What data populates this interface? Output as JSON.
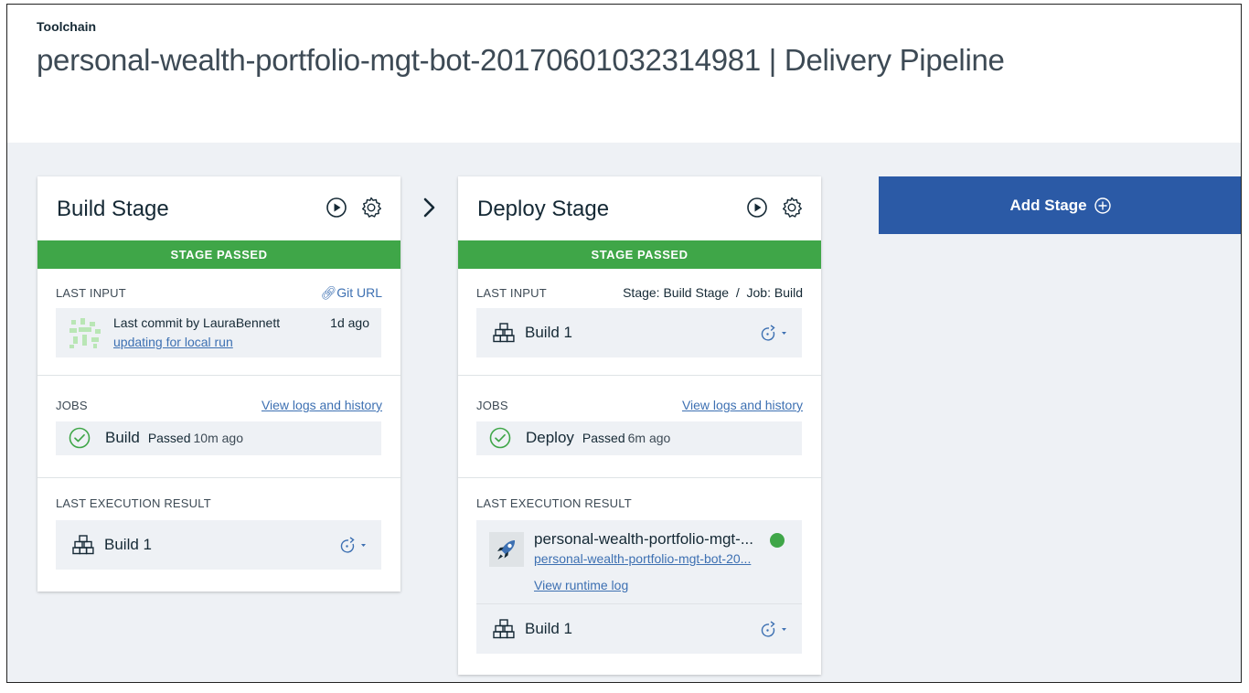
{
  "header": {
    "breadcrumb": "Toolchain",
    "title": "personal-wealth-portfolio-mgt-bot-20170601032314981 | Delivery Pipeline"
  },
  "colors": {
    "passed": "#3fa648",
    "link": "#3d70b2",
    "add_stage_bg": "#2b5aa6",
    "canvas_bg": "#eef1f5"
  },
  "add_stage": {
    "label": "Add Stage",
    "icon": "plus-circle-icon"
  },
  "build_stage": {
    "title": "Build Stage",
    "status": "STAGE PASSED",
    "last_input": {
      "label": "LAST INPUT",
      "link": "Git URL",
      "commit_text": "Last commit by LauraBennett",
      "commit_message": "updating for local run",
      "commit_time": "1d ago"
    },
    "jobs": {
      "label": "JOBS",
      "link": "View logs and history",
      "job_name": "Build",
      "job_status": "Passed",
      "job_time": "10m ago"
    },
    "last_execution": {
      "label": "LAST EXECUTION RESULT",
      "build": "Build 1"
    }
  },
  "deploy_stage": {
    "title": "Deploy Stage",
    "status": "STAGE PASSED",
    "last_input": {
      "label": "LAST INPUT",
      "source": "Stage: Build Stage  /  Job: Build",
      "build": "Build 1"
    },
    "jobs": {
      "label": "JOBS",
      "link": "View logs and history",
      "job_name": "Deploy",
      "job_status": "Passed",
      "job_time": "6m ago"
    },
    "last_execution": {
      "label": "LAST EXECUTION RESULT",
      "app_name": "personal-wealth-portfolio-mgt-...",
      "app_route": "personal-wealth-portfolio-mgt-bot-20...",
      "runtime_log": "View runtime log",
      "build": "Build 1"
    }
  }
}
